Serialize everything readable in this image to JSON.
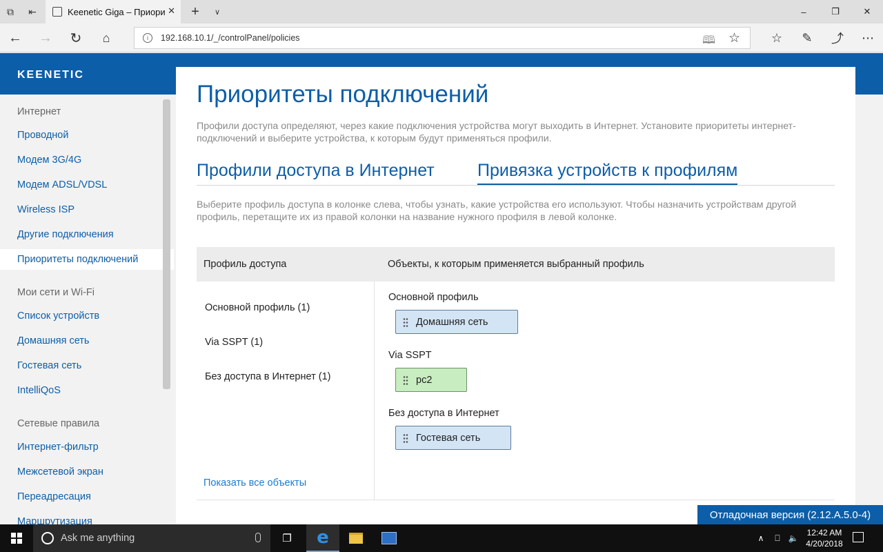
{
  "browser": {
    "tab_title": "Keenetic Giga – Приори",
    "url": "192.168.10.1/_/controlPanel/policies"
  },
  "header": {
    "logo": "KEENETIC"
  },
  "sidebar": {
    "group_internet": "Интернет",
    "items_internet": [
      "Проводной",
      "Модем 3G/4G",
      "Модем ADSL/VDSL",
      "Wireless ISP",
      "Другие подключения",
      "Приоритеты подключений"
    ],
    "group_networks": "Мои сети и Wi-Fi",
    "items_networks": [
      "Список устройств",
      "Домашняя сеть",
      "Гостевая сеть",
      "IntelliQoS"
    ],
    "group_rules": "Сетевые правила",
    "items_rules": [
      "Интернет-фильтр",
      "Межсетевой экран",
      "Переадресация",
      "Маршрутизация"
    ],
    "active_item": "Приоритеты подключений"
  },
  "main": {
    "title": "Приоритеты подключений",
    "description": "Профили доступа определяют, через какие подключения устройства могут выходить в Интернет. Установите приоритеты интернет-подключений и выберите устройства, к которым будут применяться профили.",
    "tabs": [
      "Профили доступа в Интернет",
      "Привязка устройств к профилям"
    ],
    "active_tab": "Привязка устройств к профилям",
    "hint": "Выберите профиль доступа в колонке слева, чтобы узнать, какие устройства его используют. Чтобы назначить устройствам другой профиль, перетащите их из правой колонки на название нужного профиля в левой колонке.",
    "col_profile": "Профиль доступа",
    "col_objects": "Объекты, к которым применяется выбранный профиль",
    "profiles": [
      "Основной профиль (1)",
      "Via SSPT (1)",
      "Без доступа в Интернет (1)"
    ],
    "show_all": "Показать все объекты",
    "groups": [
      {
        "label": "Основной профиль",
        "chip": "Домашняя сеть",
        "color": "#d3e5f5"
      },
      {
        "label": "Via SSPT",
        "chip": "pc2",
        "color": "#c8edc0"
      },
      {
        "label": "Без доступа в Интернет",
        "chip": "Гостевая сеть",
        "color": "#d3e5f5"
      }
    ]
  },
  "debug_badge": "Отладочная версия (2.12.A.5.0-4)",
  "taskbar": {
    "search_placeholder": "Ask me anything",
    "time": "12:42 AM",
    "date": "4/20/2018"
  }
}
